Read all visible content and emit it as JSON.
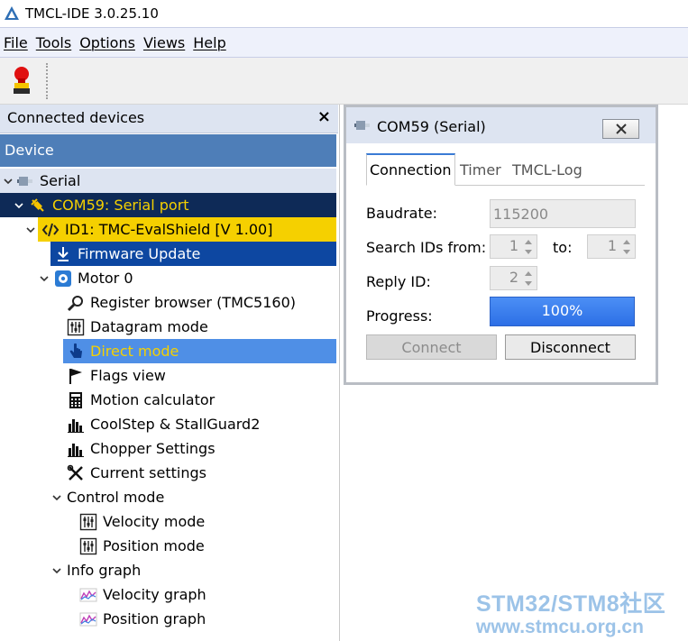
{
  "window": {
    "title": "TMCL-IDE 3.0.25.10"
  },
  "menu": {
    "items": [
      "File",
      "Tools",
      "Options",
      "Views",
      "Help"
    ]
  },
  "left_panel": {
    "title": "Connected devices",
    "close": "×",
    "column_header": "Device",
    "tree": {
      "serial": "Serial",
      "com_port": "COM59: Serial port",
      "device": "ID1: TMC-EvalShield [V 1.00]",
      "firmware_update": "Firmware Update",
      "motor": "Motor 0",
      "register_browser": "Register browser (TMC5160)",
      "datagram_mode": "Datagram mode",
      "direct_mode": "Direct mode",
      "flags_view": "Flags view",
      "motion_calculator": "Motion calculator",
      "coolstep": "CoolStep & StallGuard2",
      "chopper": "Chopper Settings",
      "current": "Current settings",
      "control_mode": "Control mode",
      "velocity_mode": "Velocity mode",
      "position_mode": "Position mode",
      "info_graph": "Info graph",
      "velocity_graph": "Velocity graph",
      "position_graph": "Position graph"
    }
  },
  "dialog": {
    "title": "COM59 (Serial)",
    "tabs": [
      "Connection",
      "Timer",
      "TMCL-Log"
    ],
    "baudrate_label": "Baudrate:",
    "baudrate_value": "115200",
    "search_ids_label": "Search IDs from:",
    "search_from_value": "1",
    "to_label": "to:",
    "search_to_value": "1",
    "reply_id_label": "Reply ID:",
    "reply_id_value": "2",
    "progress_label": "Progress:",
    "progress_percent": 100,
    "progress_text": "100%",
    "connect_label": "Connect",
    "disconnect_label": "Disconnect"
  },
  "watermark": {
    "line1": "STM32/STM8社区",
    "line2": "www.stmcu.org.cn"
  },
  "colors": {
    "selection_dark": "#0e2a57",
    "device_highlight": "#f5d000",
    "firmware_bg": "#0d47a1",
    "direct_mode_bg": "#4f8fe6",
    "column_header": "#4e7eb8"
  }
}
